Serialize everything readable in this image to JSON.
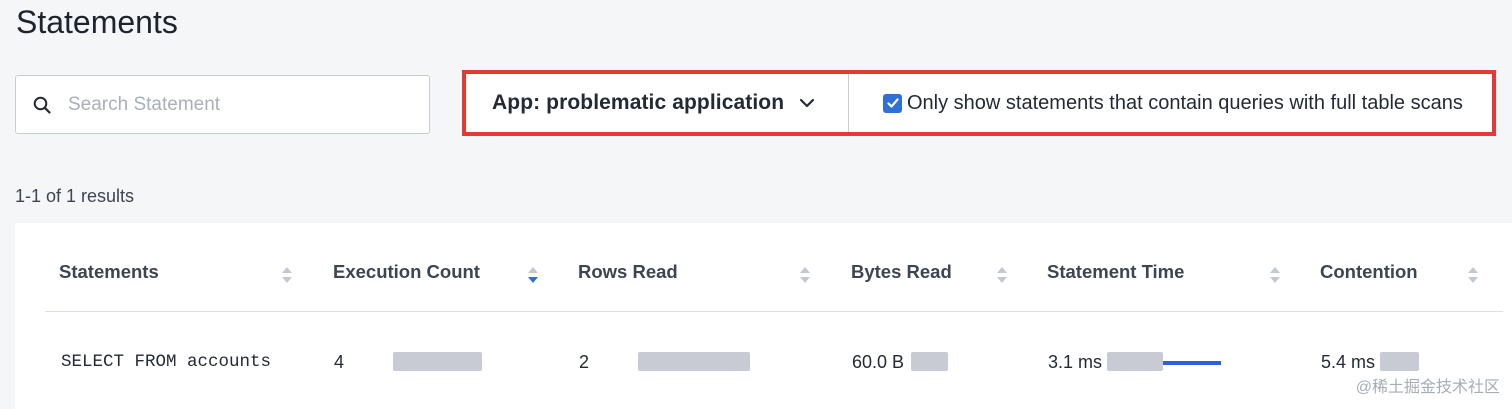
{
  "page": {
    "title": "Statements"
  },
  "search": {
    "placeholder": "Search Statement",
    "value": ""
  },
  "filters": {
    "app_label": "App: problematic application",
    "full_scan_checked": true,
    "full_scan_label": "Only show statements that contain queries with full table scans"
  },
  "results": {
    "summary": "1-1 of 1 results"
  },
  "table": {
    "columns": [
      {
        "label": "Statements",
        "sort": "none"
      },
      {
        "label": "Execution Count",
        "sort": "descending"
      },
      {
        "label": "Rows Read",
        "sort": "none"
      },
      {
        "label": "Bytes Read",
        "sort": "none"
      },
      {
        "label": "Statement Time",
        "sort": "none"
      },
      {
        "label": "Contention",
        "sort": "none"
      }
    ],
    "rows": [
      {
        "statement": "SELECT FROM accounts",
        "execution_count": "4",
        "rows_read": "2",
        "bytes_read": "60.0 B",
        "statement_time": "3.1 ms",
        "contention": "5.4 ms"
      }
    ]
  },
  "colors": {
    "accent": "#2f6fd6",
    "highlight_border": "#e53935",
    "bar": "#2d5fe0"
  },
  "icons": {
    "search": "search-icon",
    "dropdown": "chevron-down-icon",
    "sort": "sort-icon"
  },
  "watermark": "@稀土掘金技术社区"
}
